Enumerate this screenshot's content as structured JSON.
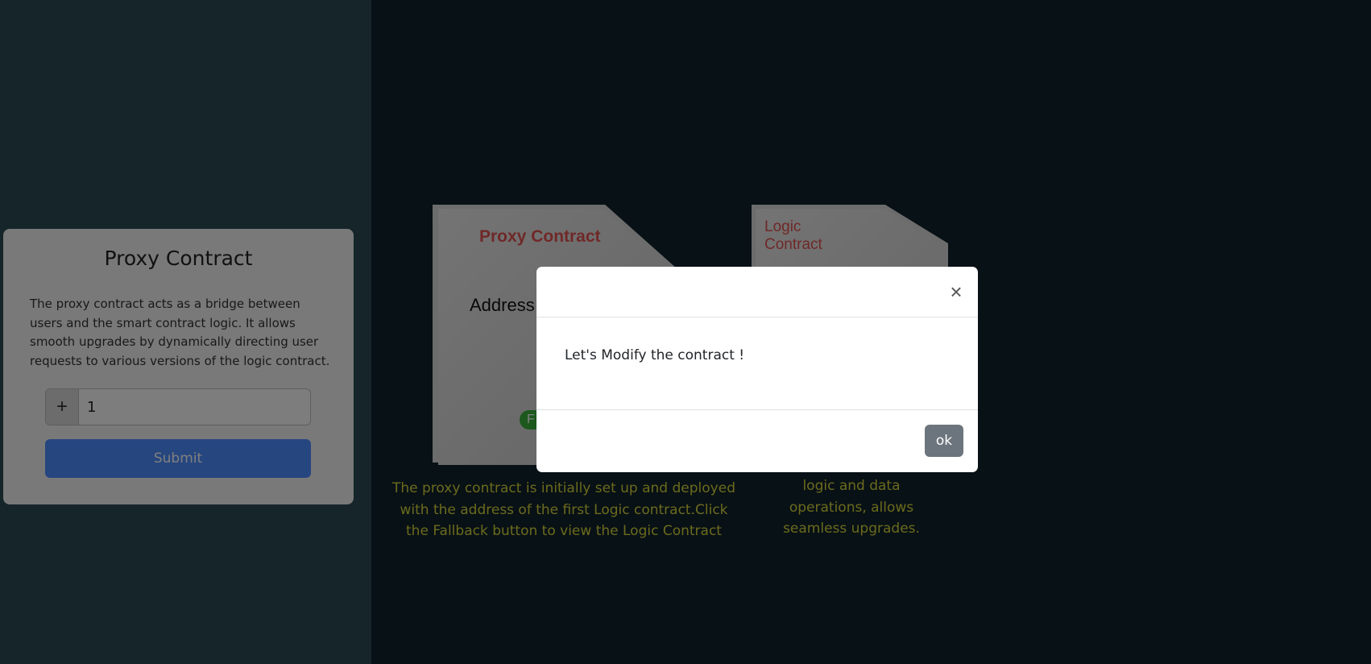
{
  "card": {
    "title": "Proxy Contract",
    "description": "The proxy contract acts as a bridge between users and the smart contract logic. It allows smooth upgrades by dynamically directing user requests to various versions of the logic contract.",
    "input_addon": "+",
    "input_value": "1",
    "submit_label": "Submit"
  },
  "diagram": {
    "proxy_doc_title": "Proxy Contract",
    "proxy_doc_text": "Address",
    "badge_text": "F",
    "logic_doc_title": "Logic Contract",
    "proxy_caption": "The proxy contract is initially set up and deployed with the address of the first Logic contract.Click the Fallback button to view the Logic Contract",
    "logic_caption": "logic and data operations, allows seamless upgrades."
  },
  "modal": {
    "close_symbol": "×",
    "message": "Let's Modify the contract !",
    "ok_label": "ok"
  },
  "colors": {
    "doc_title_red": "#e05050",
    "caption_yellow": "#d7d43a",
    "submit_blue": "#4c8cff",
    "ok_gray": "#6c757d"
  }
}
